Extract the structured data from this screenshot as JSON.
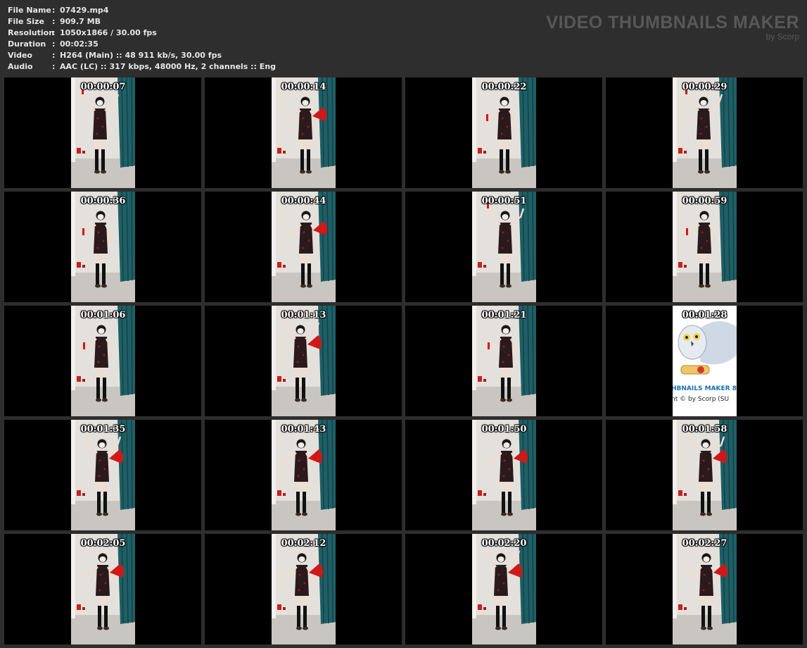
{
  "info": [
    {
      "label": "File Name",
      "sep": ":",
      "value": "07429.mp4"
    },
    {
      "label": "File Size",
      "sep": ":",
      "value": "909.7 MB"
    },
    {
      "label": "Resolution",
      "sep": ":",
      "value": "1050x1866 / 30.00 fps"
    },
    {
      "label": "Duration",
      "sep": ":",
      "value": "00:02:35"
    },
    {
      "label": "Video",
      "sep": ":",
      "value": "H264 (Main) :: 48 911 kb/s, 30.00 fps"
    },
    {
      "label": "Audio",
      "sep": ":",
      "value": "AAC (LC) :: 317 kbps, 48000 Hz, 2 channels :: Eng"
    }
  ],
  "brand": {
    "title": "VIDEO THUMBNAILS MAKER",
    "subtitle": "by Scorp"
  },
  "colors": {
    "background": "#2e2e2e",
    "curtain": "#1f5f66",
    "dress": "#2a1a1c",
    "fan": "#d01818"
  },
  "thumbnails": [
    {
      "time": "00:00:07",
      "kind": "video"
    },
    {
      "time": "00:00:14",
      "kind": "video"
    },
    {
      "time": "00:00:22",
      "kind": "video"
    },
    {
      "time": "00:00:29",
      "kind": "video"
    },
    {
      "time": "00:00:36",
      "kind": "video"
    },
    {
      "time": "00:00:44",
      "kind": "video"
    },
    {
      "time": "00:00:51",
      "kind": "video"
    },
    {
      "time": "00:00:59",
      "kind": "video"
    },
    {
      "time": "00:01:06",
      "kind": "video"
    },
    {
      "time": "00:01:13",
      "kind": "video"
    },
    {
      "time": "00:01:21",
      "kind": "video"
    },
    {
      "time": "00:01:28",
      "kind": "logo",
      "logo_line1": "HBNAILS MAKER 8",
      "logo_line2": "nt © by Scorp (SU"
    },
    {
      "time": "00:01:35",
      "kind": "video"
    },
    {
      "time": "00:01:43",
      "kind": "video"
    },
    {
      "time": "00:01:50",
      "kind": "video"
    },
    {
      "time": "00:01:58",
      "kind": "video"
    },
    {
      "time": "00:02:05",
      "kind": "video"
    },
    {
      "time": "00:02:12",
      "kind": "video"
    },
    {
      "time": "00:02:20",
      "kind": "video"
    },
    {
      "time": "00:02:27",
      "kind": "video"
    }
  ]
}
